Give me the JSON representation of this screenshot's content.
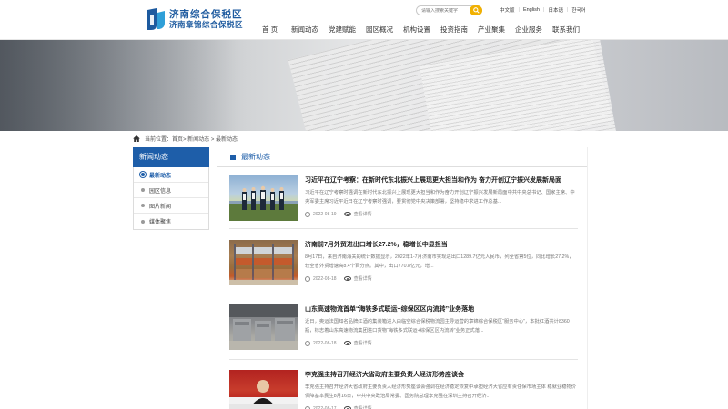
{
  "brand": {
    "name_cn": "济南综合保税区",
    "name_sub": "济南章锦综合保税区"
  },
  "search": {
    "placeholder": "请输入搜索关键字"
  },
  "languages": [
    "中文版",
    "English",
    "日本语",
    "한국어"
  ],
  "nav": [
    "首 页",
    "新闻动态",
    "党建赋能",
    "园区概况",
    "机构设置",
    "投资指南",
    "产业聚集",
    "企业服务",
    "联系我们"
  ],
  "breadcrumb": {
    "prefix": "当前位置：",
    "path": "首页> 新闻动态 > 最新动态"
  },
  "sidebar": {
    "title": "新闻动态",
    "items": [
      "最新动态",
      "园区信息",
      "图片新闻",
      "媒体聚焦"
    ]
  },
  "main": {
    "title": "最新动态",
    "view_label": "查看详情",
    "news": [
      {
        "title": "习近平在辽宁考察：在新时代东北振兴上展现更大担当和作为 奋力开创辽宁振兴发展新局面",
        "summary": "习近平在辽宁考察时强调在新时代东北振兴上展现更大担当和作为奋力开创辽宁振兴发展新局面中共中央总书记、国家主席、中央军委主席习近平近日在辽宁考察时强调，要贯彻党中央决策部署，坚持稳中求进工作总基...",
        "date": "2022-08-19"
      },
      {
        "title": "济南前7月外贸进出口增长27.2%，稳增长中显担当",
        "summary": "8月17日，来自济南海关的统计数据显示，2022年1-7月济南市实现进出口1289.7亿元人民币，列全省第5位，同比增长27.2%，较全省外贸增速高8.4个百分点。其中，出口770.8亿元，增...",
        "date": "2022-08-18"
      },
      {
        "title": "山东高速物流首单“海铁多式联运+综保区区内流转”业务落地",
        "summary": "近日，奥运法国知名品牌红酒的集装箱进入由临空综合保税物流园主导运营的章锦综合保税区“服务中心”，本批红酒共计8360瓶，标志着山东高速物流集团进口货物“海铁多式联运+综保区区内流转”业务正式落...",
        "date": "2022-08-18"
      },
      {
        "title": "李克强主持召开经济大省政府主要负责人经济形势座谈会",
        "summary": "李克强主持召开经济大省政府主要负责人经济形势座谈会强调在经济稳定恢复中承担经济大省应有责任保市场主体 稳就业稳物价保障基本民生8月16日，中共中央政治局常委、国务院总理李克强在深圳主持召开经济...",
        "date": "2022-08-17"
      }
    ]
  }
}
